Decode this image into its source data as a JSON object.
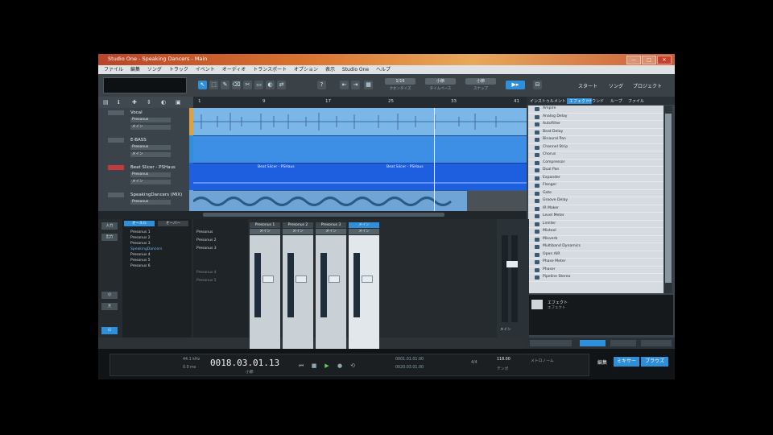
{
  "window": {
    "title": "Studio One - Speaking Dancers - Main",
    "controls": [
      "—",
      "□",
      "✕"
    ]
  },
  "menu": [
    "ファイル",
    "編集",
    "ソング",
    "トラック",
    "イベント",
    "オーディオ",
    "トランスポート",
    "オプション",
    "表示",
    "Studio One",
    "ヘルプ"
  ],
  "toolbar": {
    "tools": [
      "↖",
      "⬚",
      "✎",
      "⌫",
      "✂",
      "▭",
      "◐",
      "⇄",
      "?"
    ],
    "quantize": {
      "value": "1/16",
      "label": "クオンタイズ"
    },
    "timebase": {
      "value": "小節",
      "label": "タイムベース"
    },
    "snap": {
      "value": "小節",
      "label": "スナップ"
    },
    "nav": [
      "スタート",
      "ソング",
      "プロジェクト"
    ]
  },
  "tracks": [
    {
      "name": "Vocal",
      "input": "Presonus",
      "output": "メイン"
    },
    {
      "name": "E-BASS",
      "input": "Presonus",
      "output": "メイン"
    },
    {
      "name": "Beat Slicer - PSHaus",
      "input": "Presonus",
      "output": "メイン"
    },
    {
      "name": "SpeakingDancers (MIX)",
      "input": "Presonus",
      "output": "メイン"
    }
  ],
  "ruler": [
    "1",
    "9",
    "17",
    "25",
    "33",
    "41"
  ],
  "events": {
    "beat_slicer_a": "Beat Slicer - PSHaus",
    "beat_slicer_b": "Beat Slicer - PSHaus"
  },
  "browser": {
    "tabs": [
      "インストゥルメント",
      "エフェクト",
      "サウンド",
      "ループ",
      "ファイル"
    ],
    "fx": [
      "Ampire",
      "Analog Delay",
      "AutoFilter",
      "Beat Delay",
      "Binaural Pan",
      "Channel Strip",
      "Chorus",
      "Compressor",
      "Dual Pan",
      "Expander",
      "Flanger",
      "Gate",
      "Groove Delay",
      "IR Maker",
      "Level Meter",
      "Limiter",
      "Mixtool",
      "Mixverb",
      "Multiband Dynamics",
      "Open AIR",
      "Phase Meter",
      "Phaser",
      "Pipeline Stereo"
    ],
    "info": {
      "title": "エフェクト",
      "subtitle": "エフェクト"
    }
  },
  "mixer": {
    "view_buttons": [
      "入力",
      "出力",
      "小",
      "大",
      "IO"
    ],
    "browser_tabs": [
      "オールル",
      "オーバー"
    ],
    "browser_items": [
      "Presonus 1",
      "Presonus 2",
      "Presonus 3",
      "SpeakingDancers",
      "Presonus 4",
      "Presonus 5",
      "Presonus 6"
    ],
    "channel_list": [
      "Presonus",
      "Presonus 2",
      "Presonus 3",
      "Presonus 4",
      "Presonus 5"
    ],
    "channels": [
      {
        "name": "Presonus 1",
        "io": "メイン"
      },
      {
        "name": "Presonus 2",
        "io": "メイン"
      },
      {
        "name": "Presonus 3",
        "io": "メイン"
      },
      {
        "name": "メイン",
        "io": "メイン"
      }
    ],
    "main": "メイン"
  },
  "transport": {
    "sample_rate": "44.1 kHz",
    "latency": "0.0 ms",
    "position": "0018.03.01.13",
    "position_label": "小節",
    "loop_start": "0001.01.01.00",
    "loop_end": "0020.03.01.00",
    "signature": "4/4",
    "tempo": "118.00",
    "tempo_label": "テンポ",
    "metronome": "メトロノーム",
    "buttons": [
      "編集",
      "ミキサー",
      "ブラウズ"
    ]
  },
  "colors": {
    "accent": "#2f8fd8",
    "track_blue": "#1e7ae6",
    "vocal_lane": "#7bb6e8"
  }
}
